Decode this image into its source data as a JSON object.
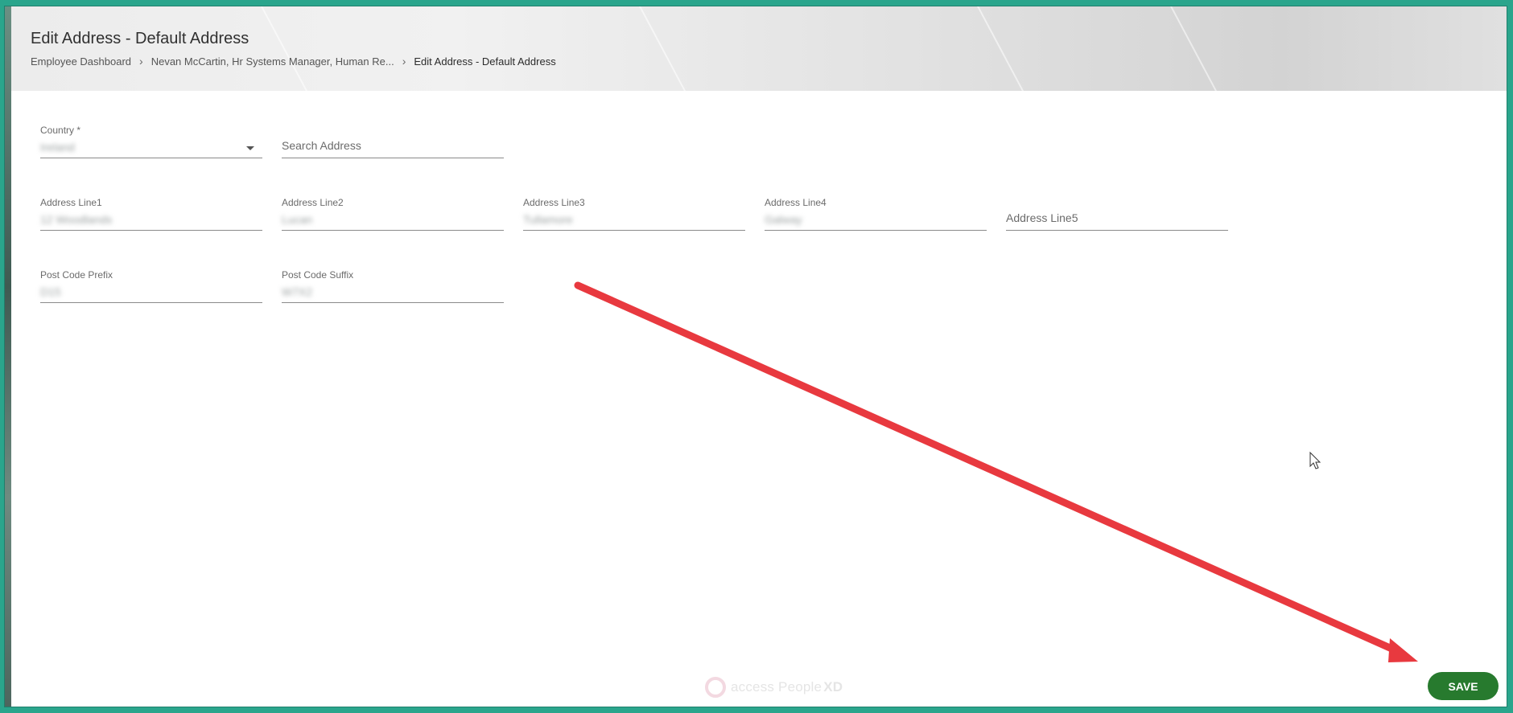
{
  "header": {
    "title": "Edit Address - Default Address",
    "breadcrumb": [
      "Employee Dashboard",
      "Nevan McCartin, Hr Systems Manager, Human Re...",
      "Edit Address - Default Address"
    ]
  },
  "form": {
    "country": {
      "label": "Country *",
      "value": "Ireland"
    },
    "search_address": {
      "placeholder": "Search Address"
    },
    "address_line1": {
      "label": "Address Line1",
      "value": "12 Woodlands"
    },
    "address_line2": {
      "label": "Address Line2",
      "value": "Lucan"
    },
    "address_line3": {
      "label": "Address Line3",
      "value": "Tullamore"
    },
    "address_line4": {
      "label": "Address Line4",
      "value": "Galway"
    },
    "address_line5": {
      "placeholder": "Address Line5"
    },
    "post_code_prefix": {
      "label": "Post Code Prefix",
      "value": "D15"
    },
    "post_code_suffix": {
      "label": "Post Code Suffix",
      "value": "W7X2"
    }
  },
  "footer": {
    "save_label": "SAVE",
    "logo_access": "access",
    "logo_people": "People",
    "logo_xd": "XD"
  },
  "colors": {
    "accent_green": "#277a2e",
    "frame_teal": "#2aa58c",
    "annotation_arrow": "#e8393f"
  },
  "icons": [
    "chevron-right-icon",
    "dropdown-caret-icon",
    "mouse-cursor-icon",
    "annotation-arrow"
  ]
}
